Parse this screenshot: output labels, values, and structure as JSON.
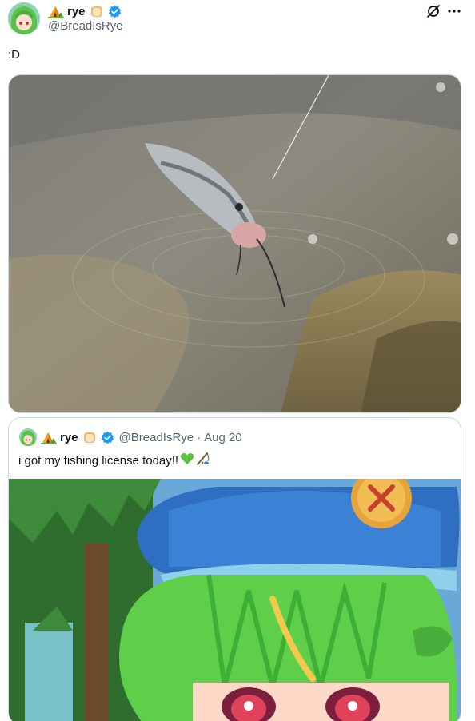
{
  "author": {
    "display_name": "rye",
    "handle": "@BreadIsRye",
    "verified": true
  },
  "post": {
    "text": ":D",
    "media_description": "photo"
  },
  "quote": {
    "display_name": "rye",
    "handle": "@BreadIsRye",
    "separator": "·",
    "date": "Aug 20",
    "text": "i got my fishing license today!!"
  },
  "icons": {
    "header": [
      "grok-icon",
      "more-icon"
    ],
    "badges": [
      "tent-emoji-icon",
      "bread-emoji-icon",
      "verified-badge-icon"
    ],
    "quote_text_emoji": [
      "green-heart-icon",
      "fishing-pole-icon"
    ]
  },
  "colors": {
    "text_primary": "#0f1419",
    "text_secondary": "#536471",
    "border": "#cfd9de",
    "verified_blue": "#1d9bf0"
  }
}
